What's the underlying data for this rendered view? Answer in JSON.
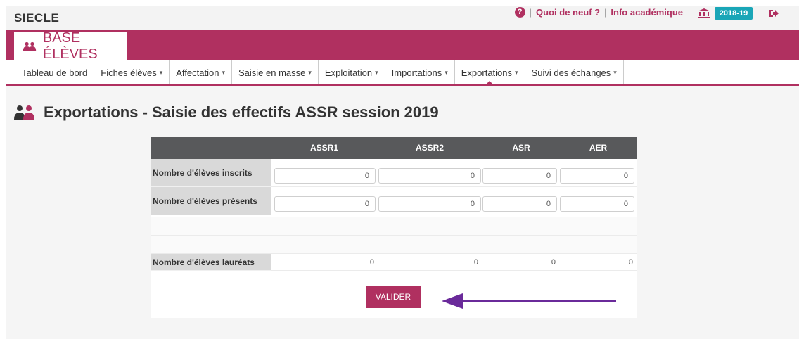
{
  "header": {
    "app_name": "SIECLE",
    "help_icon": "question-circle-icon",
    "whats_new": "Quoi de neuf ?",
    "separator": "|",
    "info": "Info académique",
    "year": "2018-19",
    "year_color": "#1aa6b7"
  },
  "brand": {
    "title": "BASE ÉLÈVES",
    "icon": "people-icon",
    "accent_color": "#b03060"
  },
  "nav": [
    {
      "label": "Tableau de bord",
      "caret": ""
    },
    {
      "label": "Fiches élèves",
      "caret": "▾"
    },
    {
      "label": "Affectation",
      "caret": "▾"
    },
    {
      "label": "Saisie en masse",
      "caret": "▾"
    },
    {
      "label": "Exploitation",
      "caret": "▾"
    },
    {
      "label": "Importations",
      "caret": "▾"
    },
    {
      "label": "Exportations",
      "caret": "▾"
    },
    {
      "label": "Suivi des échanges",
      "caret": "▾"
    }
  ],
  "page": {
    "title": "Exportations - Saisie des effectifs ASSR session 2019"
  },
  "table": {
    "columns": [
      "ASSR1",
      "ASSR2",
      "ASR",
      "AER"
    ],
    "rows": [
      {
        "label": "Nombre d'élèves inscrits",
        "values": [
          "0",
          "0",
          "0",
          "0"
        ]
      },
      {
        "label": "Nombre d'élèves présents",
        "values": [
          "0",
          "0",
          "0",
          "0"
        ]
      }
    ],
    "laureats": {
      "label": "Nombre d'élèves lauréats",
      "values": [
        "0",
        "0",
        "0",
        "0"
      ]
    }
  },
  "actions": {
    "submit": "VALIDER"
  },
  "annotation": {
    "arrow_color": "#6a2a9a"
  }
}
